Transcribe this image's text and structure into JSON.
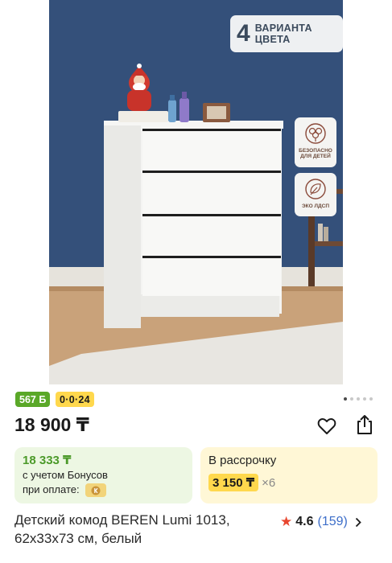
{
  "gallery": {
    "promo_number": "4",
    "promo_line1": "ВАРИАНТА",
    "promo_line2": "ЦВЕТА",
    "features": [
      {
        "line1": "БЕЗОПАСНО",
        "line2": "ДЛЯ ДЕТЕЙ",
        "icon": "cotton-flower-icon"
      },
      {
        "line1": "ЭКО ЛДСП",
        "line2": "",
        "icon": "eco-leaf-icon"
      }
    ],
    "pagination": {
      "total": 5,
      "current": 1
    }
  },
  "badges": {
    "bonus": "567 Б",
    "installment": "0·0·24"
  },
  "price": {
    "value": "18 900 ₸"
  },
  "actions": {
    "favorite_icon": "heart-icon",
    "share_icon": "share-icon"
  },
  "bonus_card": {
    "amount": "18 333 ₸",
    "line1": "с учетом Бонусов",
    "line2": "при оплате:"
  },
  "installment_card": {
    "title": "В рассрочку",
    "monthly": "3 150 ₸",
    "months": "×6"
  },
  "product": {
    "title": "Детский комод BEREN Lumi 1013, 62x33x73 см, белый",
    "rating": "4.6",
    "reviews": "(159)"
  },
  "colors": {
    "bonus_green": "#5aa828",
    "accent_yellow": "#ffd84d",
    "star_red": "#e8462f",
    "link_blue": "#3d6ec9"
  }
}
